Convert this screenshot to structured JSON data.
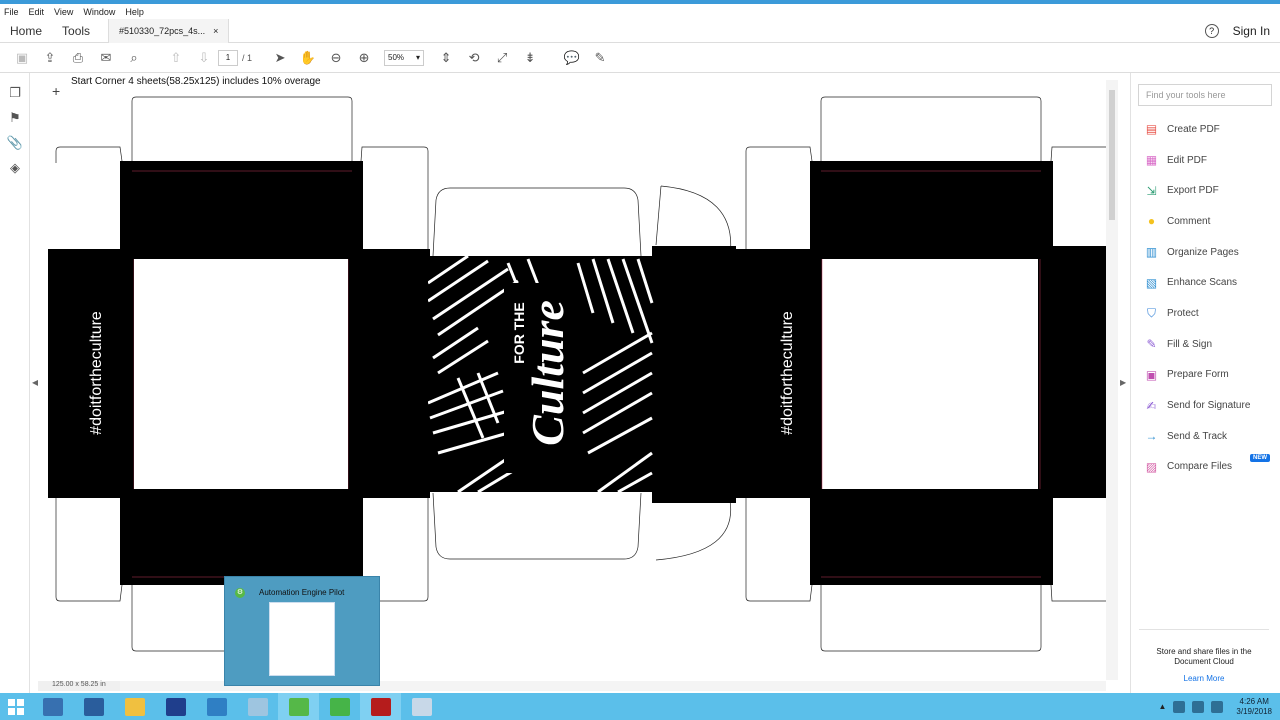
{
  "menu": [
    "File",
    "Edit",
    "View",
    "Window",
    "Help"
  ],
  "tabs": {
    "home": "Home",
    "tools": "Tools",
    "document": "#510330_72pcs_4s...",
    "close_glyph": "×",
    "help_glyph": "?",
    "sign_in": "Sign In"
  },
  "toolbar": {
    "page_current": "1",
    "page_separator": "/ 1",
    "zoom": "50%",
    "zoom_caret": "▾"
  },
  "document": {
    "label": "Start Corner 4 sheets(58.25x125) includes 10% overage",
    "hashtag_left": "#doitfortheculture",
    "hashtag_right": "#doitfortheculture",
    "center_for_the": "FOR THE",
    "center_culture": "Culture",
    "size_readout": "125.00 x 58.25 in"
  },
  "right_panel": {
    "search_placeholder": "Find your tools here",
    "tools": [
      {
        "label": "Create PDF",
        "icon": "create-pdf-icon",
        "color": "#e8534a"
      },
      {
        "label": "Edit PDF",
        "icon": "edit-pdf-icon",
        "color": "#d86ac7"
      },
      {
        "label": "Export PDF",
        "icon": "export-pdf-icon",
        "color": "#2b9b72"
      },
      {
        "label": "Comment",
        "icon": "comment-icon",
        "color": "#f4c21f"
      },
      {
        "label": "Organize Pages",
        "icon": "organize-pages-icon",
        "color": "#2f8fd1"
      },
      {
        "label": "Enhance Scans",
        "icon": "enhance-scans-icon",
        "color": "#2f8fd1"
      },
      {
        "label": "Protect",
        "icon": "protect-icon",
        "color": "#3a86d8"
      },
      {
        "label": "Fill & Sign",
        "icon": "fill-sign-icon",
        "color": "#8e5fd4"
      },
      {
        "label": "Prepare Form",
        "icon": "prepare-form-icon",
        "color": "#c04fb0"
      },
      {
        "label": "Send for Signature",
        "icon": "send-signature-icon",
        "color": "#8e5fd4"
      },
      {
        "label": "Send & Track",
        "icon": "send-track-icon",
        "color": "#2f8fd1"
      },
      {
        "label": "Compare Files",
        "icon": "compare-files-icon",
        "color": "#d45ea6"
      }
    ],
    "new_badge": "NEW",
    "cloud_text": "Store and share files in the Document Cloud",
    "learn_more": "Learn More"
  },
  "taskbar": {
    "preview_title": "Automation Engine Pilot",
    "time": "4:26 AM",
    "date": "3/19/2018"
  },
  "colors": {
    "accent": "#1473e6",
    "taskbar": "#5bbfea",
    "artwork": "#000000"
  }
}
